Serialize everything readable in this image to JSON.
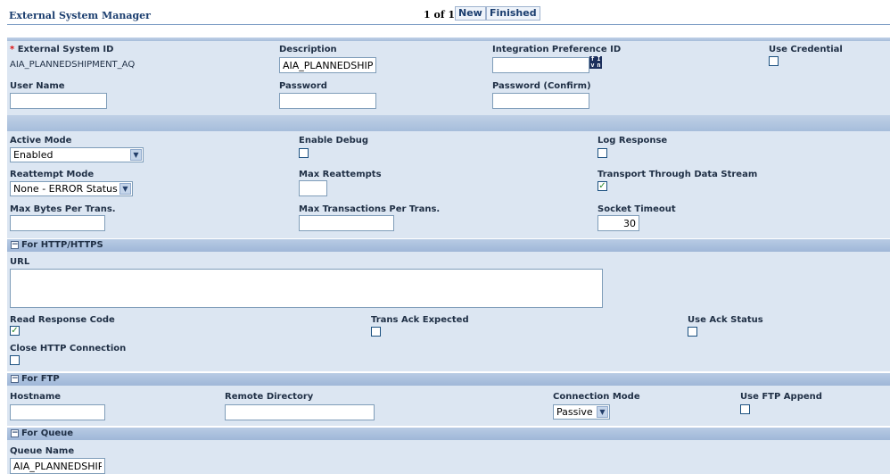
{
  "header": {
    "title": "External System Manager",
    "pager": "1 of 1",
    "new_label": "New",
    "finished_label": "Finished"
  },
  "colors": {
    "panel": "#dce6f2",
    "bar": "#a6bddb",
    "label": "#1f2f45",
    "title": "#1a3d6e",
    "required": "#d11111",
    "check": "#2b8a2b"
  },
  "top": {
    "required_mark": "*",
    "external_system_id_label": "External System ID",
    "external_system_id_value": "AIA_PLANNEDSHIPMENT_AQ",
    "description_label": "Description",
    "description_value": "AIA_PLANNEDSHIPMENT_AQ",
    "integration_pref_label": "Integration Preference ID",
    "integration_pref_value": "",
    "integration_icon": "lookup-icon",
    "integration_icon_glyph": "fIvn",
    "use_credential_label": "Use Credential",
    "use_credential_checked": false,
    "user_name_label": "User Name",
    "user_name_value": "",
    "password_label": "Password",
    "password_value": "",
    "password_confirm_label": "Password (Confirm)",
    "password_confirm_value": ""
  },
  "settings": {
    "active_mode_label": "Active Mode",
    "active_mode_value": "Enabled",
    "enable_debug_label": "Enable Debug",
    "enable_debug_checked": false,
    "log_response_label": "Log Response",
    "log_response_checked": false,
    "reattempt_mode_label": "Reattempt Mode",
    "reattempt_mode_value": "None - ERROR Status",
    "max_reattempts_label": "Max Reattempts",
    "max_reattempts_value": "",
    "transport_label": "Transport Through Data Stream",
    "transport_checked": true,
    "max_bytes_label": "Max Bytes Per Trans.",
    "max_bytes_value": "",
    "max_transactions_label": "Max Transactions Per Trans.",
    "max_transactions_value": "",
    "socket_timeout_label": "Socket Timeout",
    "socket_timeout_value": "30"
  },
  "http": {
    "section_label": "For HTTP/HTTPS",
    "toggle_glyph": "−",
    "url_label": "URL",
    "url_value": "",
    "read_response_label": "Read Response Code",
    "read_response_checked": true,
    "trans_ack_label": "Trans Ack Expected",
    "trans_ack_checked": false,
    "use_ack_label": "Use Ack Status",
    "use_ack_checked": false,
    "close_http_label": "Close HTTP Connection",
    "close_http_checked": false
  },
  "ftp": {
    "section_label": "For FTP",
    "toggle_glyph": "−",
    "hostname_label": "Hostname",
    "hostname_value": "",
    "remote_dir_label": "Remote Directory",
    "remote_dir_value": "",
    "connection_mode_label": "Connection Mode",
    "connection_mode_value": "Passive",
    "ftp_append_label": "Use FTP Append",
    "ftp_append_checked": false
  },
  "queue": {
    "section_label": "For Queue",
    "toggle_glyph": "−",
    "queue_name_label": "Queue Name",
    "queue_name_value": "AIA_PLANNEDSHIPMENT_AQ"
  },
  "glyphs": {
    "dropdown_arrow": "▼",
    "check_mark": "✓"
  }
}
